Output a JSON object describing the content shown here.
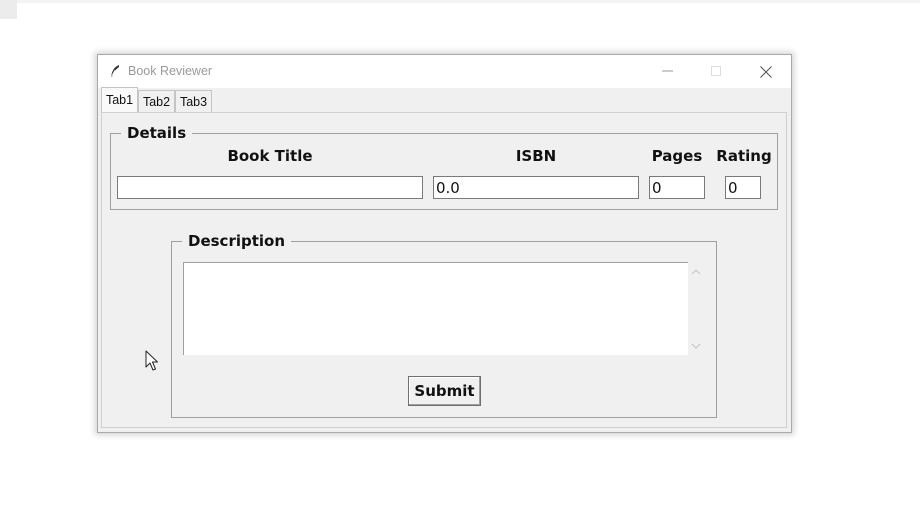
{
  "window": {
    "title": "Book Reviewer",
    "icon": "feather-icon",
    "controls": [
      "minimize-icon",
      "maximize-icon",
      "close-icon"
    ]
  },
  "tabs": [
    {
      "label": "Tab1",
      "selected": true
    },
    {
      "label": "Tab2",
      "selected": false
    },
    {
      "label": "Tab3",
      "selected": false
    }
  ],
  "details": {
    "legend": "Details",
    "columns": {
      "book_title": "Book Title",
      "isbn": "ISBN",
      "pages": "Pages",
      "rating": "Rating"
    },
    "values": {
      "book_title": "",
      "isbn": "0.0",
      "pages": "0",
      "rating": "0"
    }
  },
  "description": {
    "legend": "Description",
    "text": "",
    "submit_label": "Submit"
  }
}
